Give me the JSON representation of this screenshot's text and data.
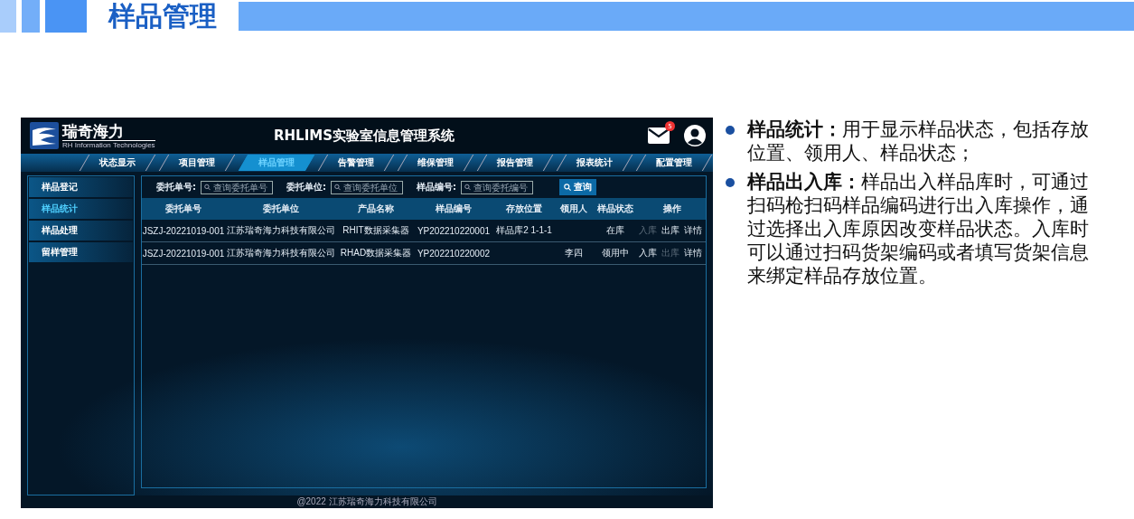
{
  "slide_title": "样品管理",
  "app": {
    "logo_name": "瑞奇海力",
    "logo_subtitle": "RH Information Technologies",
    "title": "RHLIMS实验室信息管理系统",
    "mail_badge": "5",
    "nav_tabs": [
      {
        "label": "状态显示",
        "selected": false
      },
      {
        "label": "项目管理",
        "selected": false
      },
      {
        "label": "样品管理",
        "selected": true
      },
      {
        "label": "告警管理",
        "selected": false
      },
      {
        "label": "维保管理",
        "selected": false
      },
      {
        "label": "报告管理",
        "selected": false
      },
      {
        "label": "报表统计",
        "selected": false
      },
      {
        "label": "配置管理",
        "selected": false
      }
    ],
    "sidebar": {
      "items": [
        {
          "label": "样品登记",
          "selected": false
        },
        {
          "label": "样品统计",
          "selected": true
        },
        {
          "label": "样品处理",
          "selected": false
        },
        {
          "label": "留样管理",
          "selected": false
        }
      ]
    },
    "search": {
      "fields": [
        {
          "label": "委托单号:",
          "placeholder": "查询委托单号"
        },
        {
          "label": "委托单位:",
          "placeholder": "查询委托单位"
        },
        {
          "label": "样品编号:",
          "placeholder": "查询委托编号"
        }
      ],
      "button": "查询"
    },
    "table": {
      "columns": [
        "委托单号",
        "委托单位",
        "产品名称",
        "样品编号",
        "存放位置",
        "领用人",
        "样品状态",
        "操作"
      ],
      "rows": [
        {
          "cells": [
            "JSZJ-20221019-001",
            "江苏瑞奇海力科技有限公司",
            "RHIT数据采集器",
            "YP202210220001",
            "样品库2  1-1-1",
            "",
            "在库"
          ],
          "actions": [
            {
              "label": "入库",
              "disabled": true
            },
            {
              "label": "出库",
              "disabled": false
            },
            {
              "label": "详情",
              "disabled": false
            }
          ]
        },
        {
          "cells": [
            "JSZJ-20221019-001",
            "江苏瑞奇海力科技有限公司",
            "RHAD数据采集器",
            "YP202210220002",
            "",
            "李四",
            "领用中"
          ],
          "actions": [
            {
              "label": "入库",
              "disabled": false
            },
            {
              "label": "出库",
              "disabled": true
            },
            {
              "label": "详情",
              "disabled": false
            }
          ]
        }
      ]
    },
    "footer": "@2022 江苏瑞奇海力科技有限公司"
  },
  "bullets": [
    "**样品统计：**用于显示样品状态，包括存放位置、领用人、样品状态；",
    "**样品出入库：**样品出入样品库时，可通过扫码枪扫码样品编码进行出入库操作，通过选择出入库原因改变样品状态。入库时可以通过扫码货架编码或者填写货架信息来绑定样品存放位置。"
  ]
}
